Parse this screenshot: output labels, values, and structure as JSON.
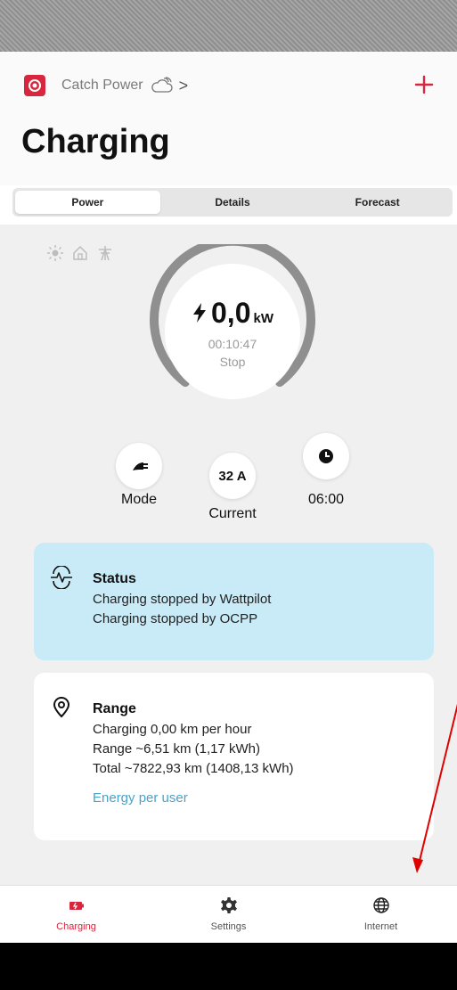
{
  "header": {
    "brand_name": "Catch Power",
    "chevron": ">",
    "title": "Charging"
  },
  "tabs": [
    {
      "label": "Power",
      "active": true
    },
    {
      "label": "Details",
      "active": false
    },
    {
      "label": "Forecast",
      "active": false
    }
  ],
  "source_icons": [
    "sun-icon",
    "home-icon",
    "grid-pylon-icon"
  ],
  "gauge": {
    "power_value": "0,0",
    "power_unit": "kW",
    "elapsed": "00:10:47",
    "action": "Stop"
  },
  "controls": {
    "mode_label": "Mode",
    "current_value": "32 A",
    "current_label": "Current",
    "timer_label": "06:00"
  },
  "status_card": {
    "title": "Status",
    "lines": [
      "Charging stopped by Wattpilot",
      "Charging stopped by OCPP"
    ]
  },
  "range_card": {
    "title": "Range",
    "lines": [
      "Charging 0,00 km per hour",
      "Range ~6,51 km (1,17 kWh)",
      "Total ~7822,93 km (1408,13 kWh)"
    ],
    "link": "Energy per user"
  },
  "bottom_nav": [
    {
      "label": "Charging",
      "icon": "battery-icon",
      "active": true
    },
    {
      "label": "Settings",
      "icon": "gear-icon",
      "active": false
    },
    {
      "label": "Internet",
      "icon": "globe-icon",
      "active": false
    }
  ],
  "colors": {
    "accent": "#d7263d",
    "status_bg": "#c8ebf7",
    "link": "#4aa3c9",
    "annotation_arrow": "#e00000"
  }
}
